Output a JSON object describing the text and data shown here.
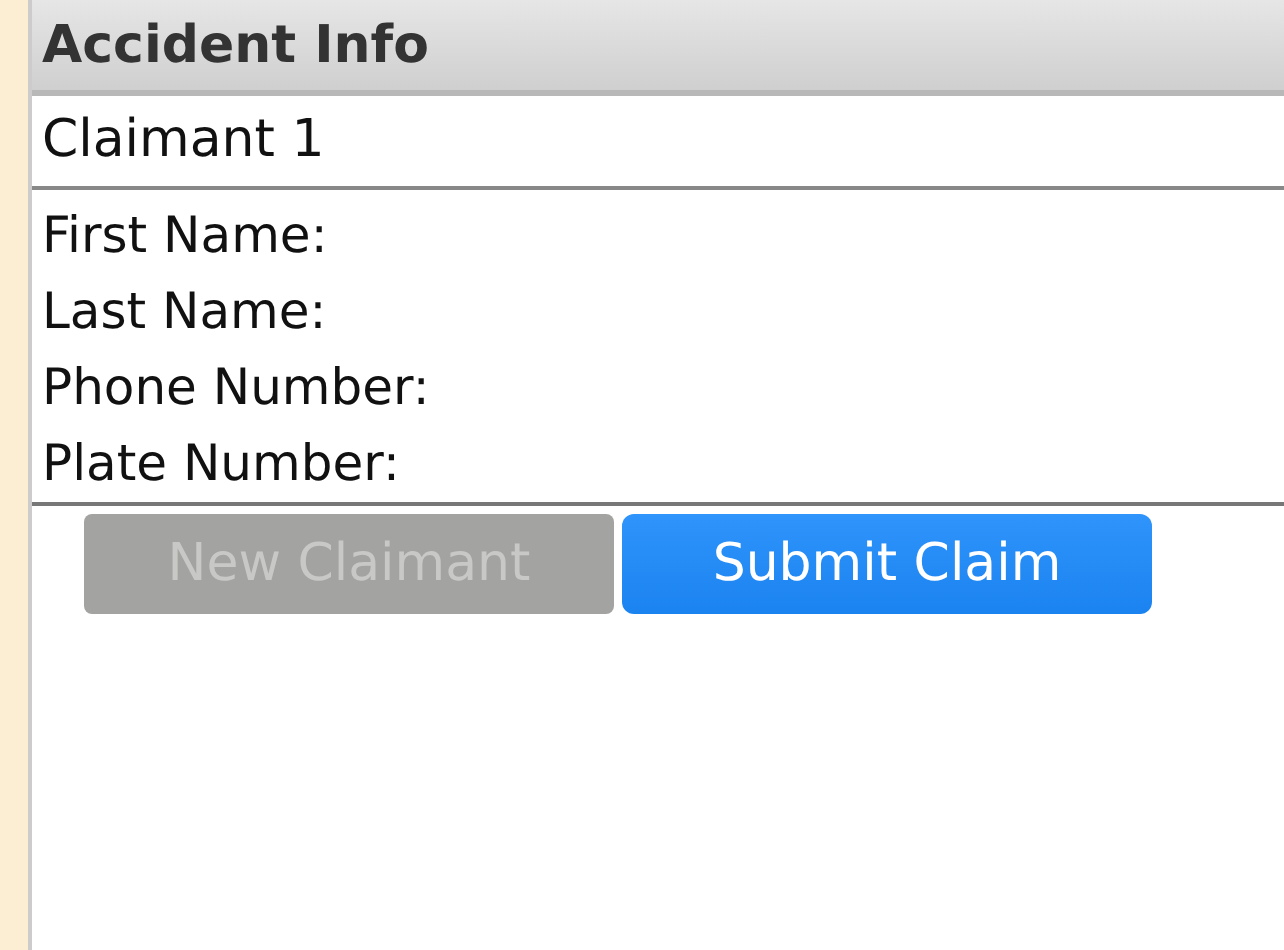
{
  "header": {
    "title": "Accident Info"
  },
  "section": {
    "title": "Claimant 1"
  },
  "fields": [
    {
      "label": "First Name:"
    },
    {
      "label": "Last Name:"
    },
    {
      "label": "Phone Number:"
    },
    {
      "label": "Plate Number:"
    }
  ],
  "buttons": [
    {
      "label": "New Claimant",
      "disabled": true
    },
    {
      "label": "Submit Claim",
      "disabled": false
    }
  ]
}
